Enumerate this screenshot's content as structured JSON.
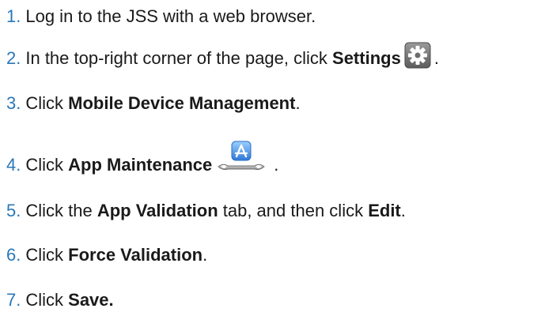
{
  "steps": [
    {
      "num": "1.",
      "text": "Log in to the JSS with a web browser."
    },
    {
      "num": "2.",
      "pre": "In the top-right corner of the page, click ",
      "bold": "Settings",
      "icon": "gear-icon",
      "post": "."
    },
    {
      "num": "3.",
      "pre": "Click ",
      "bold": "Mobile Device Management",
      "post": "."
    },
    {
      "num": "4.",
      "pre": "Click ",
      "bold": "App Maintenance",
      "icon": "app-store-wrench-icon",
      "post": "."
    },
    {
      "num": "5.",
      "pre": "Click the ",
      "bold": "App Validation",
      "mid": " tab, and then click ",
      "bold2": "Edit",
      "post": "."
    },
    {
      "num": "6.",
      "pre": "Click ",
      "bold": "Force Validation",
      "post": "."
    },
    {
      "num": "7.",
      "pre": "Click ",
      "bold": "Save."
    }
  ],
  "colors": {
    "number": "#2b78b8",
    "text": "#1a1a1a",
    "gear_bg": "#7a7a7a",
    "app_icon_blue": "#3f8fe0"
  }
}
